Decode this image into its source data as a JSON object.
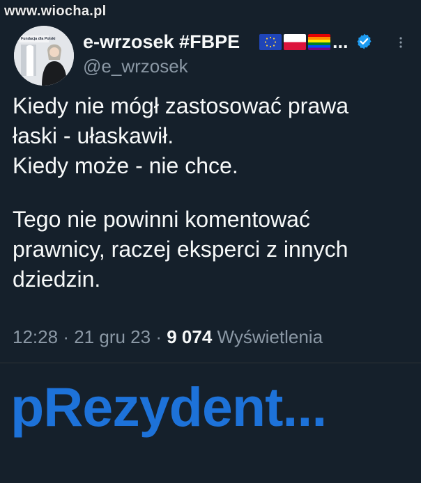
{
  "watermark": {
    "text": "www.wiocha.pl"
  },
  "tweet": {
    "author": {
      "display_name": "e-wrzosek #FBPE",
      "handle": "@e_wrzosek",
      "verified": true,
      "name_truncation": "...",
      "flags": [
        "eu-flag-icon",
        "poland-flag-icon",
        "rainbow-flag-icon"
      ]
    },
    "avatar_logo_text": "Fundacja dla Polski",
    "text_lines": [
      "Kiedy nie mógł zastosować prawa",
      "łaski - ułaskawił.",
      "Kiedy może - nie chce.",
      "",
      "Tego nie powinni komentować",
      "prawnicy, raczej eksperci z innych",
      "dziedzin."
    ],
    "meta": {
      "time": "12:28",
      "separator": "·",
      "date": "21 gru 23",
      "views_count": "9 074",
      "views_label": "Wyświetlenia"
    }
  },
  "overlay": {
    "caption": "pRezydent..."
  },
  "colors": {
    "background": "#15202b",
    "primary_text": "#f7f9f9",
    "secondary_text": "#8b98a5",
    "caption": "#1d72d9",
    "verified_badge": "#1d9bf0"
  }
}
